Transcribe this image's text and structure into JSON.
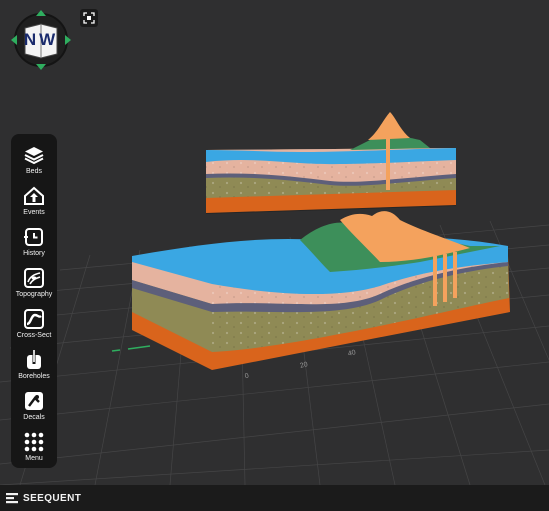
{
  "compass": {
    "heading_label": "NW"
  },
  "toolbar": {
    "items": [
      {
        "label": "Beds",
        "icon": "layers-icon"
      },
      {
        "label": "Events",
        "icon": "events-icon"
      },
      {
        "label": "History",
        "icon": "history-icon"
      },
      {
        "label": "Topography",
        "icon": "topography-icon"
      },
      {
        "label": "Cross-Sect",
        "icon": "cross-section-icon"
      },
      {
        "label": "Boreholes",
        "icon": "borehole-icon"
      },
      {
        "label": "Decals",
        "icon": "decals-icon"
      },
      {
        "label": "Menu",
        "icon": "grid-menu-icon"
      }
    ]
  },
  "grid_axis": {
    "tick_labels": [
      "0",
      "20",
      "40"
    ]
  },
  "footer": {
    "brand_name": "SEEQUENT"
  },
  "colors": {
    "background": "#2f2f30",
    "toolbar": "#161616",
    "water": "#3aa7e3",
    "sandstone": "#e5b39f",
    "shale": "#5d5f7a",
    "siltstone": "#8f8a55",
    "basement": "#d9641c",
    "vegetation": "#3d8f5a",
    "intrusion": "#f4a25d"
  }
}
